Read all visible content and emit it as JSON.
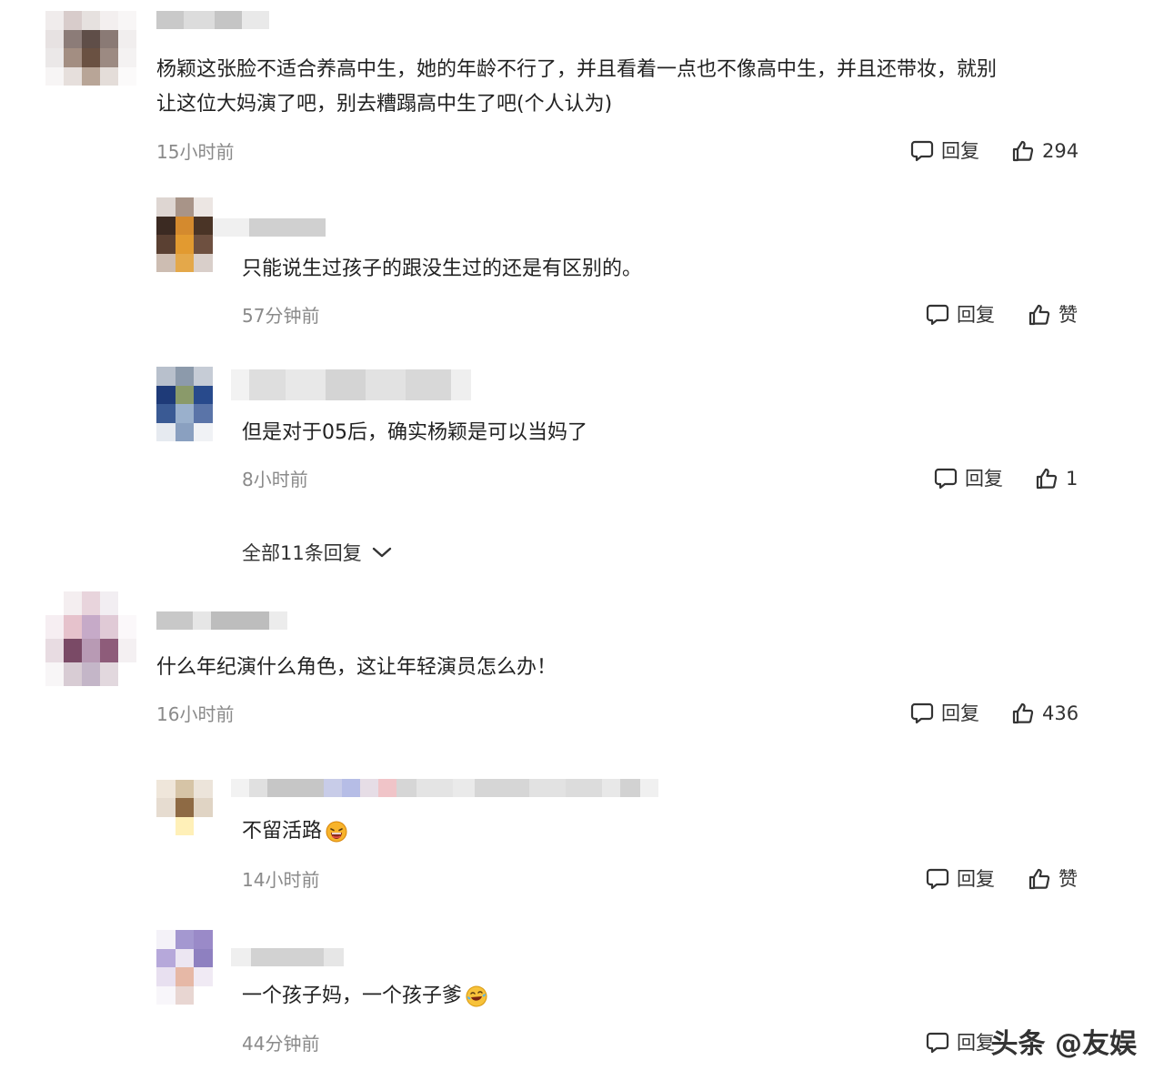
{
  "comments": [
    {
      "text_line1": "杨颖这张脸不适合养高中生，她的年龄不行了，并且看着一点也不像高中生，并且还带妆，就别",
      "text_line2": "让这位大妈演了吧，别去糟蹋高中生了吧(个人认为)",
      "time": "15小时前",
      "reply_label": "回复",
      "like_label": "294",
      "replies": [
        {
          "text": "只能说生过孩子的跟没生过的还是有区别的。",
          "time": "57分钟前",
          "reply_label": "回复",
          "like_label": "赞"
        },
        {
          "text": "但是对于05后，确实杨颖是可以当妈了",
          "time": "8小时前",
          "reply_label": "回复",
          "like_label": "1"
        }
      ],
      "expand_label": "全部11条回复"
    },
    {
      "text": "什么年纪演什么角色，这让年轻演员怎么办！",
      "time": "16小时前",
      "reply_label": "回复",
      "like_label": "436",
      "replies": [
        {
          "text": "不留活路",
          "emoji": "grinning-sweat-emoji",
          "time": "14小时前",
          "reply_label": "回复",
          "like_label": "赞"
        },
        {
          "text": "一个孩子妈，一个孩子爹",
          "emoji": "laughing-tears-emoji",
          "time": "44分钟前",
          "reply_label": "回复"
        }
      ]
    }
  ],
  "watermark": "头条 @友娱",
  "colors": {
    "time_gray": "#8a8a8a",
    "text": "#222222",
    "icon": "#333333"
  }
}
